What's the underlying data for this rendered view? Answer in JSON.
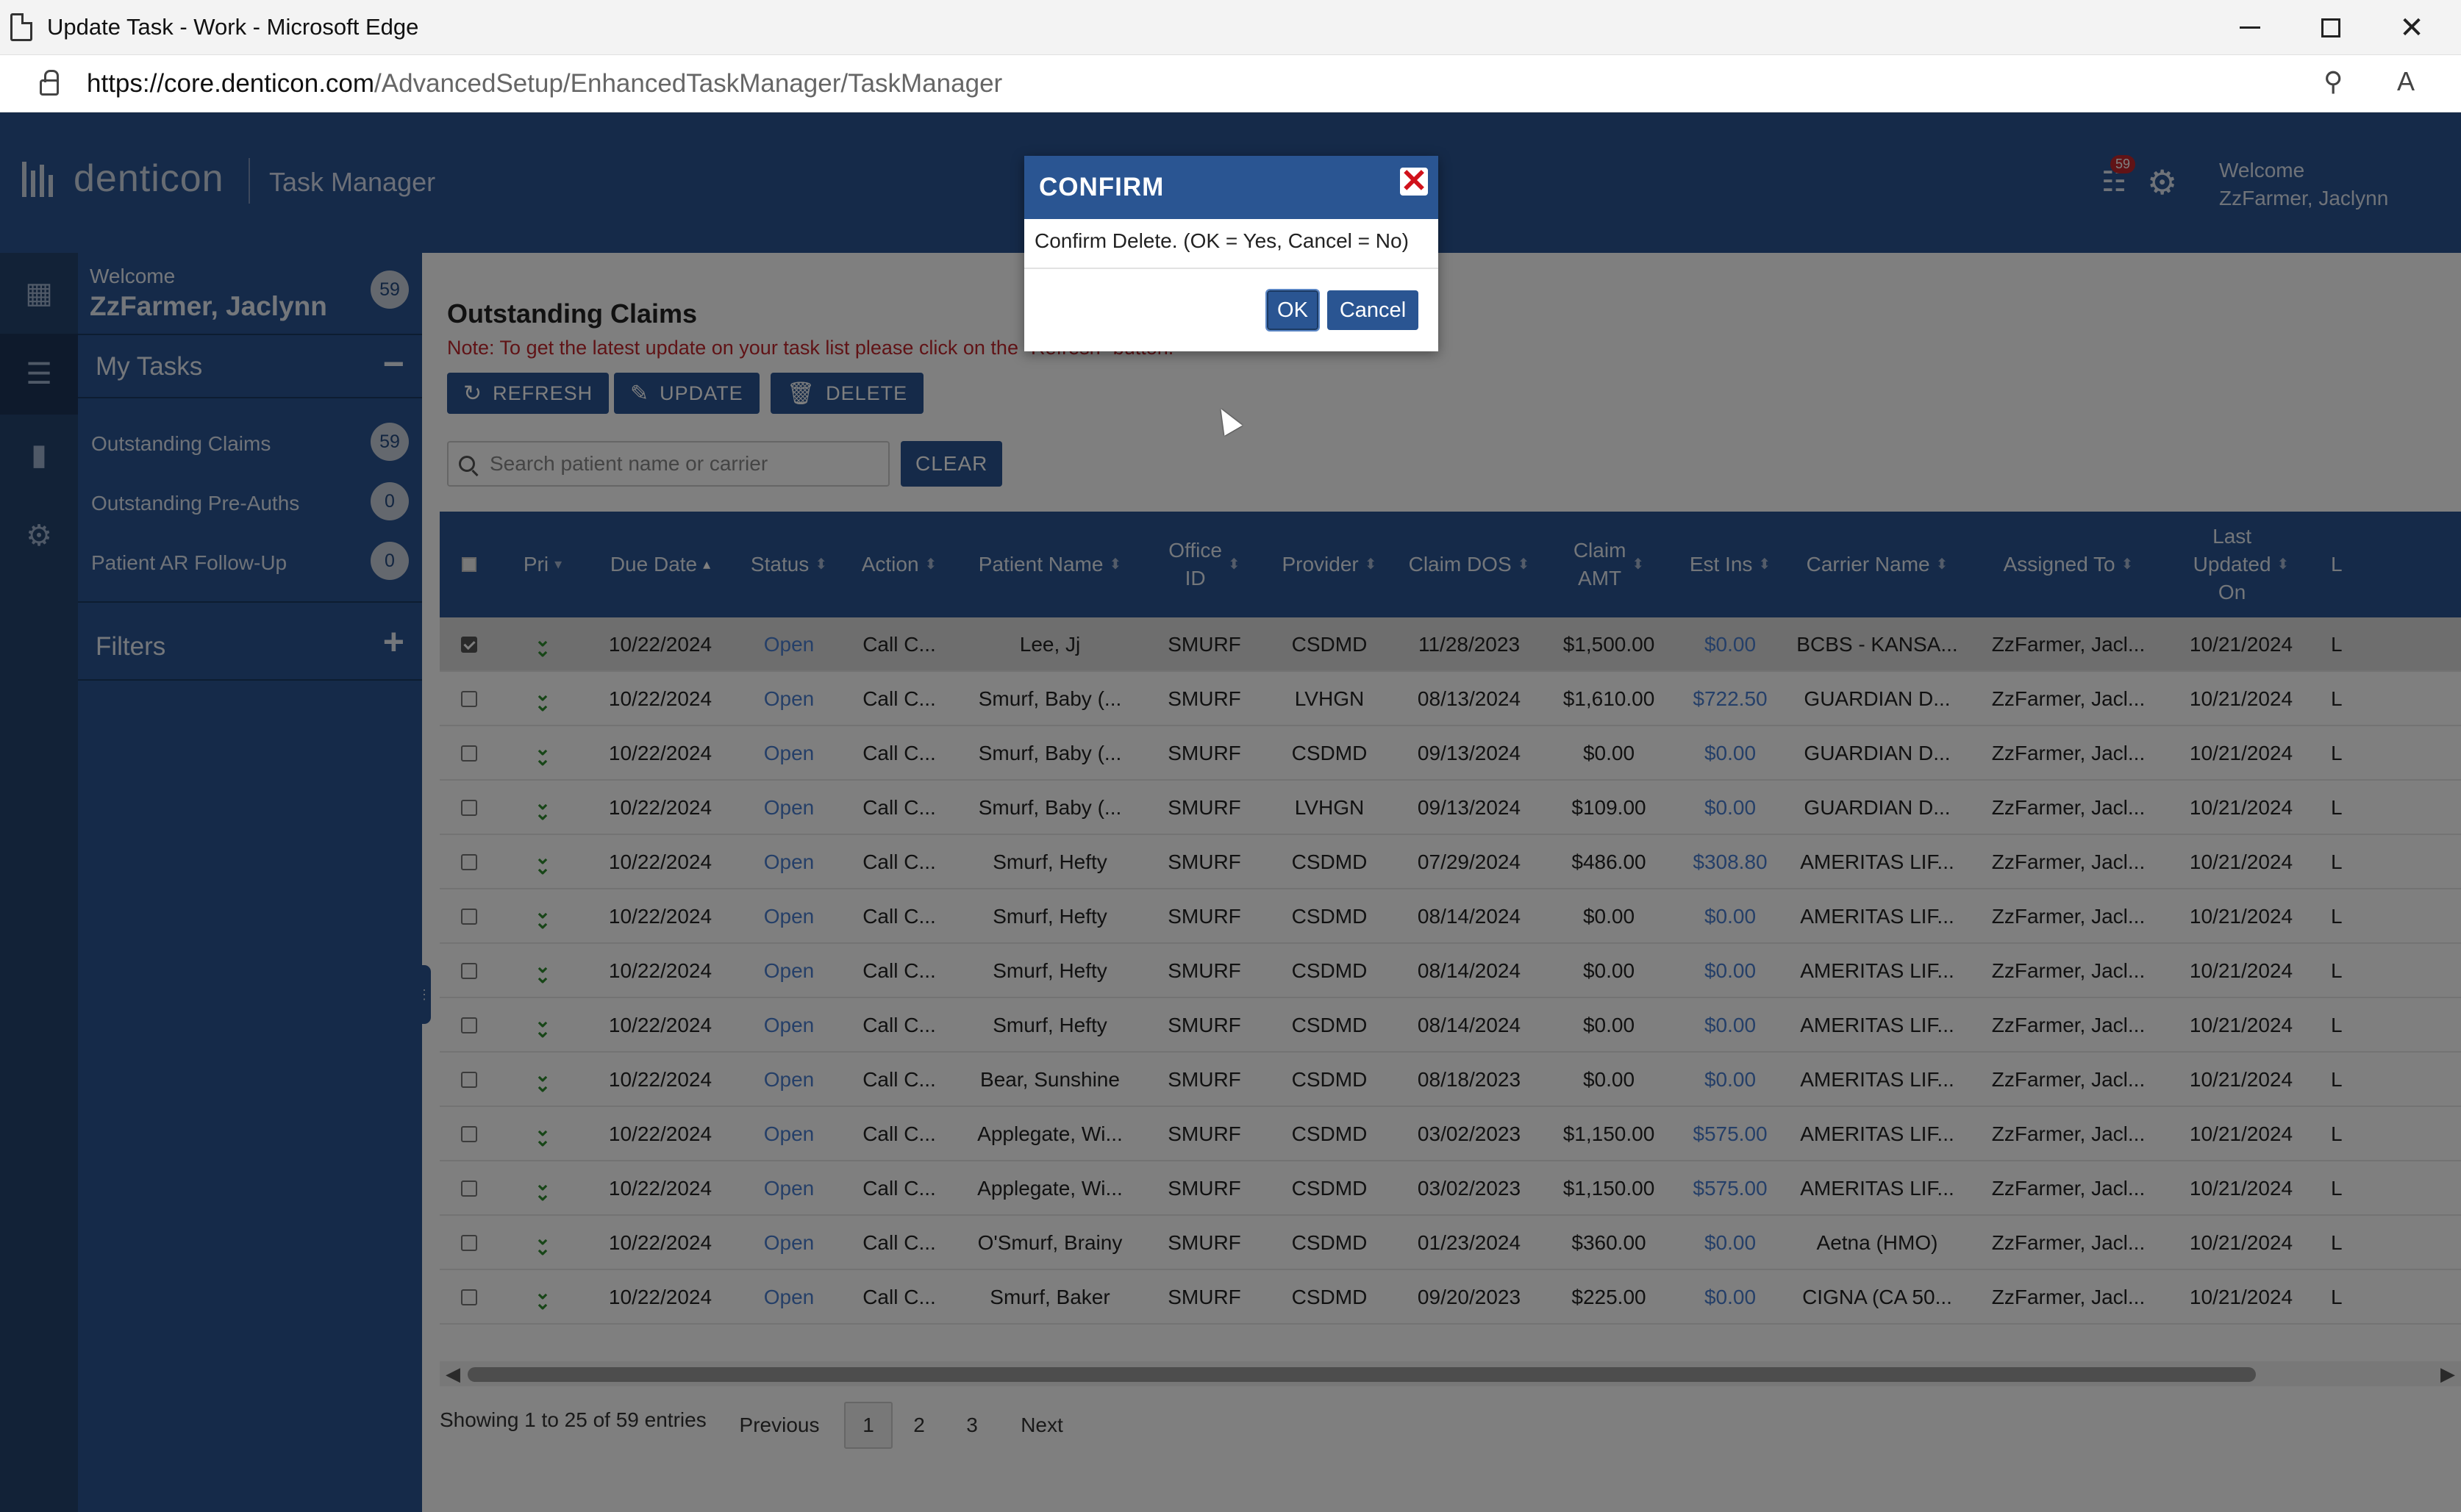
{
  "browser": {
    "window_title": "Update Task - Work - Microsoft Edge",
    "url_host": "https://core.denticon.com",
    "url_path": "/AdvancedSetup/EnhancedTaskManager/TaskManager"
  },
  "header": {
    "logo_text": "denticon",
    "app_name": "Task Manager",
    "notif_count": "59",
    "welcome_label": "Welcome",
    "user_name": "ZzFarmer, Jaclynn"
  },
  "sidebar": {
    "welcome_label": "Welcome",
    "user_name": "ZzFarmer, Jaclynn",
    "total_count": "59",
    "my_tasks_label": "My Tasks",
    "my_tasks_toggle": "−",
    "items": [
      {
        "label": "Outstanding Claims",
        "count": "59"
      },
      {
        "label": "Outstanding Pre-Auths",
        "count": "0"
      },
      {
        "label": "Patient AR Follow-Up",
        "count": "0"
      }
    ],
    "filters_label": "Filters",
    "filters_toggle": "+"
  },
  "main": {
    "title": "Outstanding Claims",
    "note": "Note: To get the latest update on your task list please click on the \"Refresh\" button.",
    "refresh_label": "REFRESH",
    "update_label": "UPDATE",
    "delete_label": "DELETE",
    "search_placeholder": "Search patient name or carrier",
    "clear_label": "CLEAR"
  },
  "table": {
    "headers": {
      "pri": "Pri",
      "due_date": "Due Date",
      "status": "Status",
      "action": "Action",
      "patient_name": "Patient Name",
      "office_id_1": "Office",
      "office_id_2": "ID",
      "provider": "Provider",
      "claim_dos": "Claim DOS",
      "claim_amt_1": "Claim",
      "claim_amt_2": "AMT",
      "est_ins": "Est Ins",
      "carrier_name": "Carrier Name",
      "assigned_to": "Assigned To",
      "last_updated_1": "Last",
      "last_updated_2": "Updated",
      "last_updated_3": "On",
      "overflow": "L"
    },
    "rows": [
      {
        "due": "10/22/2024",
        "status": "Open",
        "action": "Call C...",
        "patient": "Lee, Jj",
        "office": "SMURF",
        "provider": "CSDMD",
        "dos": "11/28/2023",
        "amt": "$1,500.00",
        "est": "$0.00",
        "carrier": "BCBS - KANSA...",
        "assigned": "ZzFarmer, Jacl...",
        "updated": "10/21/2024",
        "more": "L"
      },
      {
        "due": "10/22/2024",
        "status": "Open",
        "action": "Call C...",
        "patient": "Smurf, Baby (...",
        "office": "SMURF",
        "provider": "LVHGN",
        "dos": "08/13/2024",
        "amt": "$1,610.00",
        "est": "$722.50",
        "carrier": "GUARDIAN D...",
        "assigned": "ZzFarmer, Jacl...",
        "updated": "10/21/2024",
        "more": "L"
      },
      {
        "due": "10/22/2024",
        "status": "Open",
        "action": "Call C...",
        "patient": "Smurf, Baby (...",
        "office": "SMURF",
        "provider": "CSDMD",
        "dos": "09/13/2024",
        "amt": "$0.00",
        "est": "$0.00",
        "carrier": "GUARDIAN D...",
        "assigned": "ZzFarmer, Jacl...",
        "updated": "10/21/2024",
        "more": "L"
      },
      {
        "due": "10/22/2024",
        "status": "Open",
        "action": "Call C...",
        "patient": "Smurf, Baby (...",
        "office": "SMURF",
        "provider": "LVHGN",
        "dos": "09/13/2024",
        "amt": "$109.00",
        "est": "$0.00",
        "carrier": "GUARDIAN D...",
        "assigned": "ZzFarmer, Jacl...",
        "updated": "10/21/2024",
        "more": "L"
      },
      {
        "due": "10/22/2024",
        "status": "Open",
        "action": "Call C...",
        "patient": "Smurf, Hefty",
        "office": "SMURF",
        "provider": "CSDMD",
        "dos": "07/29/2024",
        "amt": "$486.00",
        "est": "$308.80",
        "carrier": "AMERITAS LIF...",
        "assigned": "ZzFarmer, Jacl...",
        "updated": "10/21/2024",
        "more": "L"
      },
      {
        "due": "10/22/2024",
        "status": "Open",
        "action": "Call C...",
        "patient": "Smurf, Hefty",
        "office": "SMURF",
        "provider": "CSDMD",
        "dos": "08/14/2024",
        "amt": "$0.00",
        "est": "$0.00",
        "carrier": "AMERITAS LIF...",
        "assigned": "ZzFarmer, Jacl...",
        "updated": "10/21/2024",
        "more": "L"
      },
      {
        "due": "10/22/2024",
        "status": "Open",
        "action": "Call C...",
        "patient": "Smurf, Hefty",
        "office": "SMURF",
        "provider": "CSDMD",
        "dos": "08/14/2024",
        "amt": "$0.00",
        "est": "$0.00",
        "carrier": "AMERITAS LIF...",
        "assigned": "ZzFarmer, Jacl...",
        "updated": "10/21/2024",
        "more": "L"
      },
      {
        "due": "10/22/2024",
        "status": "Open",
        "action": "Call C...",
        "patient": "Smurf, Hefty",
        "office": "SMURF",
        "provider": "CSDMD",
        "dos": "08/14/2024",
        "amt": "$0.00",
        "est": "$0.00",
        "carrier": "AMERITAS LIF...",
        "assigned": "ZzFarmer, Jacl...",
        "updated": "10/21/2024",
        "more": "L"
      },
      {
        "due": "10/22/2024",
        "status": "Open",
        "action": "Call C...",
        "patient": "Bear, Sunshine",
        "office": "SMURF",
        "provider": "CSDMD",
        "dos": "08/18/2023",
        "amt": "$0.00",
        "est": "$0.00",
        "carrier": "AMERITAS LIF...",
        "assigned": "ZzFarmer, Jacl...",
        "updated": "10/21/2024",
        "more": "L"
      },
      {
        "due": "10/22/2024",
        "status": "Open",
        "action": "Call C...",
        "patient": "Applegate, Wi...",
        "office": "SMURF",
        "provider": "CSDMD",
        "dos": "03/02/2023",
        "amt": "$1,150.00",
        "est": "$575.00",
        "carrier": "AMERITAS LIF...",
        "assigned": "ZzFarmer, Jacl...",
        "updated": "10/21/2024",
        "more": "L"
      },
      {
        "due": "10/22/2024",
        "status": "Open",
        "action": "Call C...",
        "patient": "Applegate, Wi...",
        "office": "SMURF",
        "provider": "CSDMD",
        "dos": "03/02/2023",
        "amt": "$1,150.00",
        "est": "$575.00",
        "carrier": "AMERITAS LIF...",
        "assigned": "ZzFarmer, Jacl...",
        "updated": "10/21/2024",
        "more": "L"
      },
      {
        "due": "10/22/2024",
        "status": "Open",
        "action": "Call C...",
        "patient": "O'Smurf, Brainy",
        "office": "SMURF",
        "provider": "CSDMD",
        "dos": "01/23/2024",
        "amt": "$360.00",
        "est": "$0.00",
        "carrier": "Aetna (HMO)",
        "assigned": "ZzFarmer, Jacl...",
        "updated": "10/21/2024",
        "more": "L"
      },
      {
        "due": "10/22/2024",
        "status": "Open",
        "action": "Call C...",
        "patient": "Smurf, Baker",
        "office": "SMURF",
        "provider": "CSDMD",
        "dos": "09/20/2023",
        "amt": "$225.00",
        "est": "$0.00",
        "carrier": "CIGNA (CA 50...",
        "assigned": "ZzFarmer, Jacl...",
        "updated": "10/21/2024",
        "more": "L"
      }
    ]
  },
  "footer": {
    "info": "Showing 1 to 25 of 59 entries",
    "previous": "Previous",
    "pages": [
      "1",
      "2",
      "3"
    ],
    "next": "Next"
  },
  "dialog": {
    "title": "CONFIRM",
    "close": "✕",
    "message": "Confirm Delete. (OK = Yes, Cancel = No)",
    "ok": "OK",
    "cancel": "Cancel"
  }
}
